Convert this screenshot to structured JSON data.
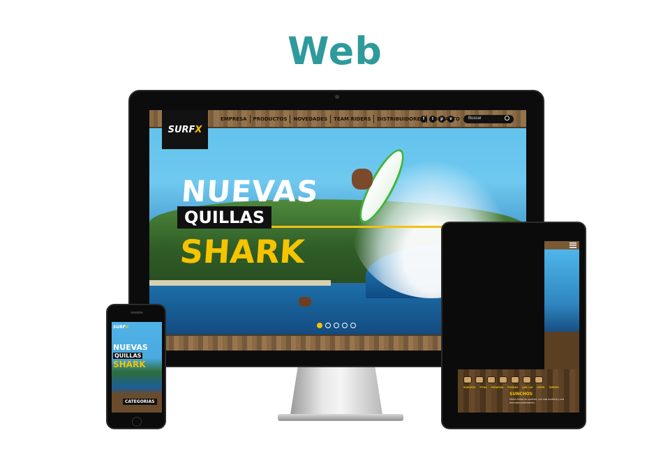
{
  "headline": "Web",
  "desktop": {
    "logo": {
      "text": "SURF",
      "accent": "X"
    },
    "menu": [
      "EMPRESA",
      "PRODUCTOS",
      "NOVEDADES",
      "TEAM RIDERS",
      "DISTRIBUIDORES",
      "CONTACTO"
    ],
    "social_icons": [
      "facebook-icon",
      "twitter-icon",
      "pinterest-icon",
      "vimeo-icon"
    ],
    "social_glyphs": [
      "f",
      "t",
      "p",
      "v"
    ],
    "search_placeholder": "Buscar",
    "hero": {
      "line1": "NUEVAS",
      "line2": "QUILLAS",
      "line3": "SHARK"
    },
    "carousel": {
      "count": 5,
      "active": 0
    },
    "colors": {
      "accent": "#f5c400",
      "headline": "#2e9a9c"
    }
  },
  "tablet": {
    "heading": "SUNCHOS",
    "categories": [
      "SUNCHOS",
      "PITAS",
      "PARAFINA",
      "FUNDAS",
      "QUILLAS",
      "GRIPS",
      "TARROS"
    ],
    "body": "Nuevo lineas de sunchos, con mas modelos y una renovada presentacion."
  },
  "phone": {
    "logo": {
      "text": "SURF",
      "accent": "X"
    },
    "hero": {
      "line1": "NUEVAS",
      "line2": "QUILLAS",
      "line3": "SHARK"
    },
    "categories_label": "CATEGORIAS"
  }
}
